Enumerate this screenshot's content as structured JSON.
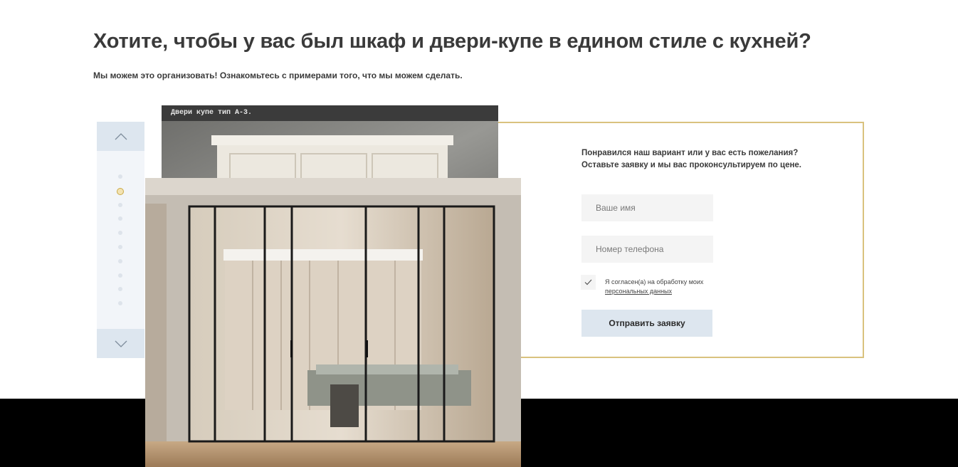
{
  "header": {
    "title": "Хотите, чтобы у вас был шкаф и двери-купе в едином стиле с кухней?",
    "subtitle": "Мы можем это организовать! Ознакомьтесь с примерами того, что мы можем сделать."
  },
  "slider": {
    "up_icon": "chevron-up-icon",
    "down_icon": "chevron-down-icon",
    "dot_count": 10,
    "active_index": 1,
    "back_caption": "Двери купе тип А-3."
  },
  "form": {
    "line1": "Понравился наш вариант или у вас есть пожелания?",
    "line2": "Оставьте заявку и мы вас проконсультируем по цене.",
    "name_placeholder": "Ваше имя",
    "phone_placeholder": "Номер телефона",
    "consent_text": "Я согласен(а) на обработку моих",
    "consent_link": "персональных данных",
    "submit_label": "Отправить заявку",
    "checkbox_checked": true
  },
  "colors": {
    "accent_gold": "#d9c27e",
    "button_bg": "#dde6ef",
    "field_bg": "#f4f4f4"
  }
}
